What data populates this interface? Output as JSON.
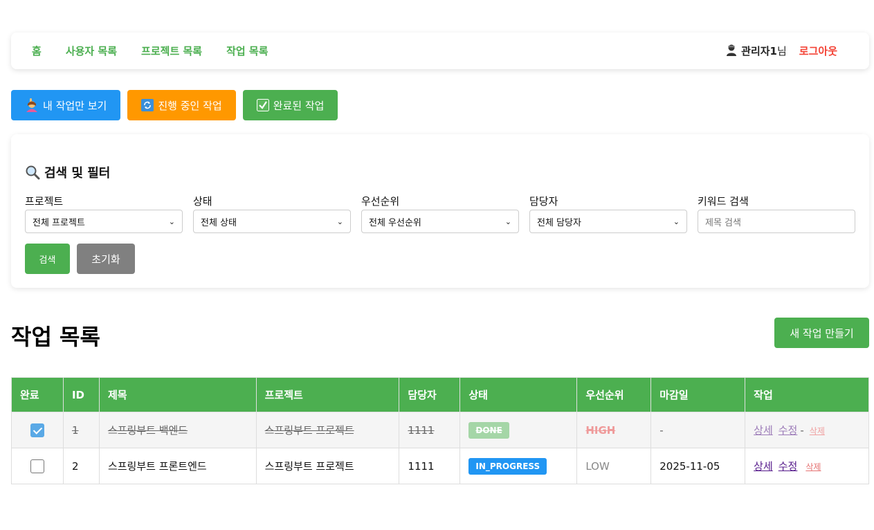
{
  "nav": {
    "links": [
      "홈",
      "사용자 목록",
      "프로젝트 목록",
      "작업 목록"
    ],
    "user_name": "관리자1",
    "user_suffix": "님",
    "logout": "로그아웃"
  },
  "quick_filters": {
    "mine": "내 작업만 보기",
    "in_progress": "진행 중인 작업",
    "completed": "완료된 작업"
  },
  "filter": {
    "title": "검색 및 필터",
    "project_label": "프로젝트",
    "project_value": "전체 프로젝트",
    "status_label": "상태",
    "status_value": "전체 상태",
    "priority_label": "우선순위",
    "priority_value": "전체 우선순위",
    "assignee_label": "담당자",
    "assignee_value": "전체 담당자",
    "keyword_label": "키워드 검색",
    "keyword_placeholder": "제목 검색",
    "search_button": "검색",
    "reset_button": "초기화"
  },
  "page": {
    "title": "작업 목록",
    "new_task_button": "새 작업 만들기"
  },
  "table": {
    "headers": [
      "완료",
      "ID",
      "제목",
      "프로젝트",
      "담당자",
      "상태",
      "우선순위",
      "마감일",
      "작업"
    ],
    "rows": [
      {
        "done": true,
        "id": "1",
        "title": "스프링부트 백엔드",
        "project": "스프링부트 프로젝트",
        "assignee": "1111",
        "status": "DONE",
        "priority": "HIGH",
        "due": "-",
        "detail": "상세",
        "edit": "수정",
        "sep": "-",
        "delete": "삭제"
      },
      {
        "done": false,
        "id": "2",
        "title": "스프링부트 프론트엔드",
        "project": "스프링부트 프로젝트",
        "assignee": "1111",
        "status": "IN_PROGRESS",
        "priority": "LOW",
        "due": "2025-11-05",
        "detail": "상세",
        "edit": "수정",
        "delete": "삭제"
      }
    ]
  },
  "colors": {
    "accent_green": "#4caf50",
    "blue": "#2196f3",
    "orange": "#ff9800",
    "logout_red": "#f44336"
  }
}
